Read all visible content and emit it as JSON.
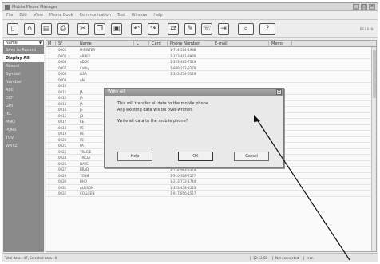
{
  "window": {
    "title": "Mobile Phone Manager",
    "controls": [
      "_",
      "□",
      "×"
    ]
  },
  "menu": [
    "File",
    "Edit",
    "View",
    "Phone Book",
    "Communication",
    "Tool",
    "Window",
    "Help"
  ],
  "toolbar": {
    "buttons": [
      {
        "name": "new-icon",
        "glyph": "▯"
      },
      {
        "name": "open-icon",
        "glyph": "⌂"
      },
      {
        "name": "save-icon",
        "glyph": "▤"
      },
      {
        "name": "print-icon",
        "glyph": "⎙"
      },
      {
        "name": "cut-icon",
        "glyph": "✂"
      },
      {
        "name": "copy-icon",
        "glyph": "❐"
      },
      {
        "name": "paste-icon",
        "glyph": "▣"
      },
      {
        "name": "undo-icon",
        "glyph": "↶"
      },
      {
        "name": "redo-icon",
        "glyph": "↷"
      },
      {
        "name": "sync-icon",
        "glyph": "⇄"
      },
      {
        "name": "edit-icon",
        "glyph": "✎"
      },
      {
        "name": "phone-icon",
        "glyph": "☏"
      },
      {
        "name": "transfer-icon",
        "glyph": "⇥"
      },
      {
        "name": "find-icon",
        "glyph": "⌕"
      },
      {
        "name": "help-icon",
        "glyph": "?"
      }
    ],
    "right_text": "BELKIN"
  },
  "sidebar": {
    "header": "Name",
    "items": [
      {
        "label": "Save to Record",
        "selected": false
      },
      {
        "label": "Display All",
        "selected": true
      },
      {
        "label": "Absent",
        "selected": false
      },
      {
        "label": "Symbol",
        "selected": false
      },
      {
        "label": "Number",
        "selected": false
      },
      {
        "label": "ABC",
        "selected": false
      },
      {
        "label": "DEF",
        "selected": false
      },
      {
        "label": "GHI",
        "selected": false
      },
      {
        "label": "JKL",
        "selected": false
      },
      {
        "label": "MNO",
        "selected": false
      },
      {
        "label": "PQRS",
        "selected": false
      },
      {
        "label": "TUV",
        "selected": false
      },
      {
        "label": "WXYZ",
        "selected": false
      }
    ]
  },
  "grid": {
    "columns": [
      "M",
      "S/",
      "Name",
      "L",
      "Card",
      "Phone Number",
      "E-mail",
      "Memo"
    ],
    "rows": [
      [
        "",
        "0001",
        "MINISTER",
        "",
        "",
        "1-714-514-1988",
        "",
        ""
      ],
      [
        "",
        "0002",
        "ABBEY",
        "",
        "",
        "1-323-461-9930",
        "",
        ""
      ],
      [
        "",
        "0003",
        "ADDY",
        "",
        "",
        "1-323-465-7519",
        "",
        ""
      ],
      [
        "",
        "0007",
        "Cathy",
        "",
        "",
        "1-949-212-3270",
        "",
        ""
      ],
      [
        "",
        "0008",
        "LISA",
        "",
        "",
        "1-323-254-6119",
        "",
        ""
      ],
      [
        "",
        "0009",
        "AN",
        "",
        "",
        "",
        "",
        ""
      ],
      [
        "",
        "0010",
        "",
        "",
        "",
        "",
        "",
        ""
      ],
      [
        "",
        "0011",
        "JA",
        "",
        "",
        "",
        "",
        ""
      ],
      [
        "",
        "0012",
        "JA",
        "",
        "",
        "",
        "",
        ""
      ],
      [
        "",
        "0013",
        "JA",
        "",
        "",
        "",
        "",
        ""
      ],
      [
        "",
        "0014",
        "JE",
        "",
        "",
        "",
        "",
        ""
      ],
      [
        "",
        "0016",
        "JO",
        "",
        "",
        "",
        "",
        ""
      ],
      [
        "",
        "0017",
        "KE",
        "",
        "",
        "",
        "",
        ""
      ],
      [
        "",
        "0018",
        "PE",
        "",
        "",
        "",
        "",
        ""
      ],
      [
        "",
        "0019",
        "PE",
        "",
        "",
        "",
        "",
        ""
      ],
      [
        "",
        "0020",
        "PE",
        "",
        "",
        "",
        "",
        ""
      ],
      [
        "",
        "0021",
        "PA",
        "",
        "",
        "",
        "",
        ""
      ],
      [
        "",
        "0022",
        "TRACIE",
        "",
        "",
        "1-858-552-4442",
        "",
        ""
      ],
      [
        "",
        "0023",
        "TRICIA",
        "",
        "",
        "1-626-972-6889",
        "",
        ""
      ],
      [
        "",
        "0025",
        "DAVE",
        "",
        "",
        "1-714-958-8846",
        "",
        ""
      ],
      [
        "",
        "0027",
        "BRAD",
        "",
        "",
        "1-714-963-4570",
        "",
        ""
      ],
      [
        "",
        "0029",
        "TONIE",
        "",
        "",
        "1-310-318-4577",
        "",
        ""
      ],
      [
        "",
        "0030",
        "BHO",
        "",
        "",
        "1-213-772-1744",
        "",
        ""
      ],
      [
        "",
        "0031",
        "ALLISON",
        "",
        "",
        "1-323-478-8523",
        "",
        ""
      ],
      [
        "",
        "0032",
        "COLLEEN",
        "",
        "",
        "1-917-856-1517",
        "",
        ""
      ]
    ]
  },
  "status": {
    "left": "Total data : 47,  Selected data : 0",
    "cells": [
      "12:13:58",
      "Not connected",
      "Icon"
    ]
  },
  "dialog": {
    "title": "Write All",
    "close": "×",
    "message_line1": "This will transfer all data to the mobile phone.",
    "message_line2": "Any existing data will be over-written.",
    "question": "Write all data to the mobile phone?",
    "help_label": "Help",
    "ok_label": "OK",
    "cancel_label": "Cancel"
  }
}
